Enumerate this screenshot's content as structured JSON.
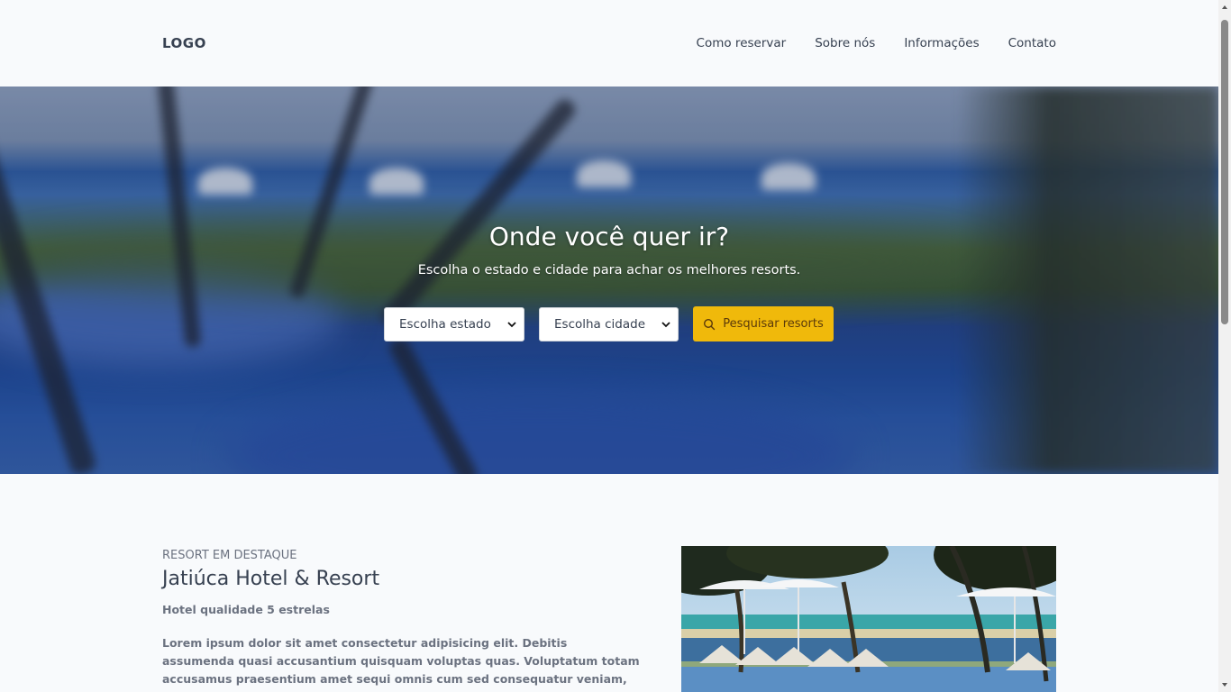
{
  "header": {
    "logo": "LOGO",
    "nav": [
      "Como reservar",
      "Sobre nós",
      "Informações",
      "Contato"
    ]
  },
  "hero": {
    "title": "Onde você quer ir?",
    "subtitle": "Escolha o estado e cidade para achar os melhores resorts.",
    "state_select": "Escolha estado",
    "city_select": "Escolha cidade",
    "search_button": "Pesquisar resorts",
    "search_icon": "search-icon"
  },
  "featured": {
    "kicker": "RESORT EM DESTAQUE",
    "title": "Jatiúca Hotel & Resort",
    "subtitle": "Hotel qualidade 5 estrelas",
    "body": "Lorem ipsum dolor sit amet consectetur adipisicing elit. Debitis assumenda quasi accusantium quisquam voluptas quas. Voluptatum totam accusamus praesentium amet sequi omnis cum sed consequatur veniam, aperiam eum saepe sunt."
  },
  "colors": {
    "accent": "#f0b90b",
    "text": "#374151",
    "muted": "#6b7280",
    "background": "#f8fafc"
  }
}
